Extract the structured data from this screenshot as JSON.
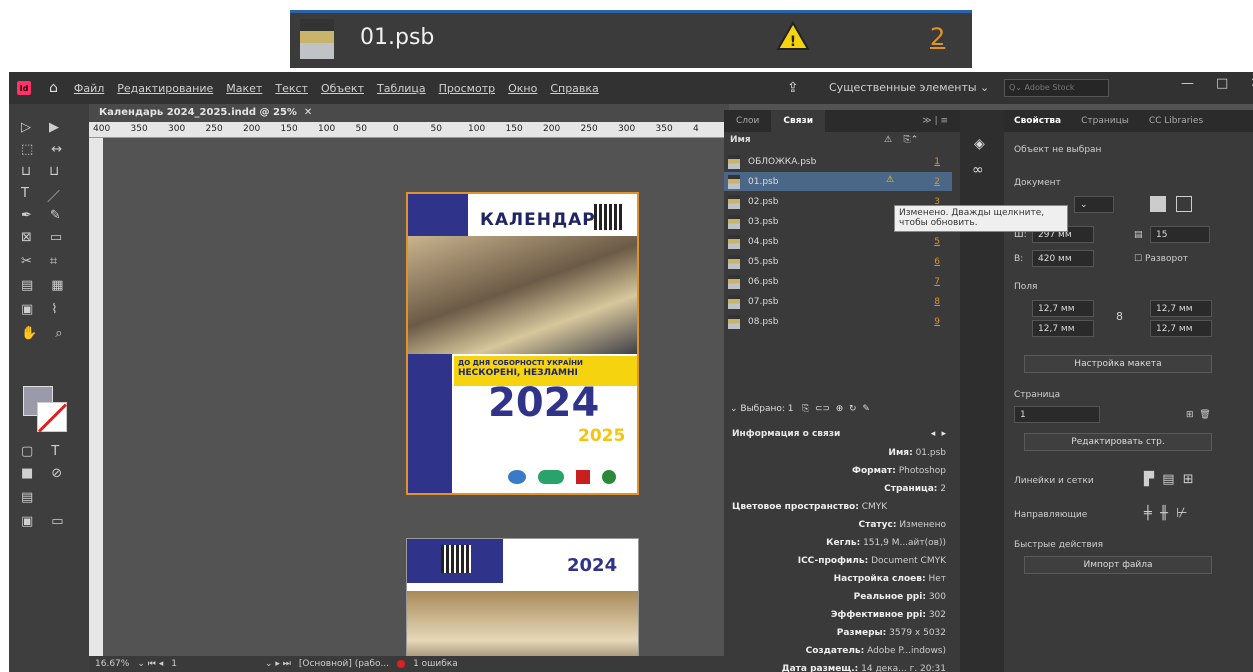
{
  "zoom_row": {
    "name": "01.psb",
    "page": "2"
  },
  "menubar": {
    "logo": "Id",
    "items": [
      "Файл",
      "Редактирование",
      "Макет",
      "Текст",
      "Объект",
      "Таблица",
      "Просмотр",
      "Окно",
      "Справка"
    ],
    "workspace": "Существенные элементы",
    "search_placeholder": "Adobe Stock"
  },
  "document": {
    "tab": "Календарь 2024_2025.indd @ 25%",
    "ruler": [
      "400",
      "350",
      "300",
      "250",
      "200",
      "150",
      "100",
      "50",
      "0",
      "50",
      "100",
      "150",
      "200",
      "250",
      "300",
      "350",
      "4"
    ]
  },
  "page1": {
    "title": "КАЛЕНДАРЬ",
    "line1": "ДО ДНЯ СОБОРНОСТІ УКРАЇНИ",
    "line2": "НЕСКОРЕНІ, НЕЗЛАМНІ",
    "year1": "2024",
    "year2": "2025"
  },
  "page2": {
    "year": "2024"
  },
  "statusbar": {
    "zoom": "16.67%",
    "page": "1",
    "style": "[Основной] (рабо...",
    "errors": "1 ошибка"
  },
  "links_panel": {
    "tabs": [
      "Слои",
      "Связи"
    ],
    "header_name": "Имя",
    "rows": [
      {
        "name": "ОБЛОЖКА.psb",
        "page": "1"
      },
      {
        "name": "01.psb",
        "page": "2"
      },
      {
        "name": "02.psb",
        "page": "3"
      },
      {
        "name": "03.psb",
        "page": "4"
      },
      {
        "name": "04.psb",
        "page": "5"
      },
      {
        "name": "05.psb",
        "page": "6"
      },
      {
        "name": "06.psb",
        "page": "7"
      },
      {
        "name": "07.psb",
        "page": "8"
      },
      {
        "name": "08.psb",
        "page": "9"
      }
    ],
    "tooltip": "Изменено. Дважды щелкните, чтобы обновить.",
    "selected": "Выбрано: 1",
    "info_title": "Информация о связи",
    "info": [
      {
        "k": "Имя:",
        "v": "01.psb"
      },
      {
        "k": "Формат:",
        "v": "Photoshop"
      },
      {
        "k": "Страница:",
        "v": "2"
      },
      {
        "k": "Цветовое пространство:",
        "v": "CMYK"
      },
      {
        "k": "Статус:",
        "v": "Изменено"
      },
      {
        "k": "Кегль:",
        "v": "151,9 М...айт(ов))"
      },
      {
        "k": "ICC-профиль:",
        "v": "Document CMYK"
      },
      {
        "k": "Настройка слоев:",
        "v": "Нет"
      },
      {
        "k": "Реальное ppi:",
        "v": "300"
      },
      {
        "k": "Эффективное ppi:",
        "v": "302"
      },
      {
        "k": "Размеры:",
        "v": "3579 x 5032"
      },
      {
        "k": "Создатель:",
        "v": "Adobe P...indows)"
      },
      {
        "k": "Дата размещ.:",
        "v": "14 дека... г. 20:31"
      }
    ]
  },
  "properties": {
    "tabs": [
      "Свойства",
      "Страницы",
      "CC Libraries"
    ],
    "no_selection": "Объект не выбран",
    "document": "Документ",
    "w_label": "Ш:",
    "w": "297 мм",
    "h_label": "В:",
    "h": "420 мм",
    "pages": "15",
    "spread": "Разворот",
    "margins": "Поля",
    "m1": "12,7 мм",
    "m2": "12,7 мм",
    "m3": "12,7 мм",
    "m4": "12,7 мм",
    "layout_btn": "Настройка макета",
    "page_label": "Страница",
    "page_value": "1",
    "edit_page": "Редактировать стр.",
    "rulers": "Линейки и сетки",
    "guides": "Направляющие",
    "quick": "Быстрые действия",
    "import": "Импорт файла"
  },
  "colors": {
    "accent": "#e0922b",
    "selection": "#4b6788",
    "brand_blue": "#30338a",
    "brand_yellow": "#f5d40f"
  }
}
